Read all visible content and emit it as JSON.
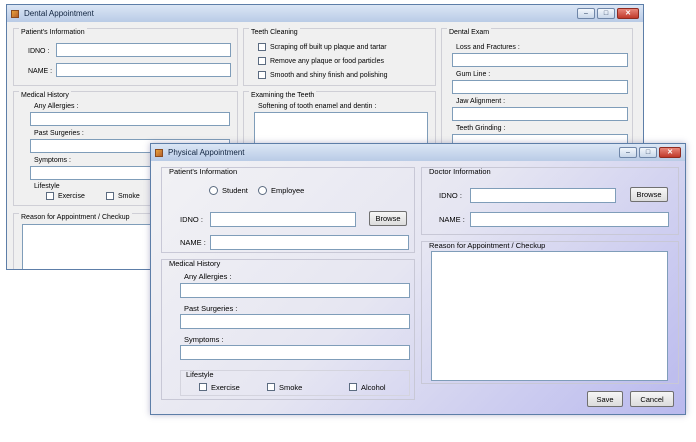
{
  "dental": {
    "title": "Dental Appointment",
    "patients_info": {
      "legend": "Patient's Information",
      "idno_label": "IDNO :",
      "name_label": "NAME :"
    },
    "medical_history": {
      "legend": "Medical History",
      "allergies_label": "Any Allergies :",
      "surgeries_label": "Past Surgeries :",
      "symptoms_label": "Symptoms :",
      "lifestyle_label": "Lifestyle",
      "exercise_label": "Exercise",
      "smoke_label": "Smoke"
    },
    "reason": {
      "legend": "Reason for Appointment / Checkup"
    },
    "teeth_cleaning": {
      "legend": "Teeth Cleaning",
      "opt1": "Scraping off built up plaque and tartar",
      "opt2": "Remove any plaque or food particles",
      "opt3": "Smooth and shiny finish and polishing"
    },
    "examining": {
      "legend": "Examining the Teeth",
      "softening_label": "Softening of tooth enamel and dentin :"
    },
    "dental_exam": {
      "legend": "Dental Exam",
      "loss_label": "Loss and Fractures :",
      "gum_label": "Gum Line :",
      "jaw_label": "Jaw Alignment :",
      "grinding_label": "Teeth Grinding :"
    },
    "caption": {
      "min": "–",
      "max": "□",
      "close": "✕"
    }
  },
  "physical": {
    "title": "Physical Appointment",
    "patients_info": {
      "legend": "Patient's Information",
      "student_label": "Student",
      "employee_label": "Employee",
      "idno_label": "IDNO :",
      "name_label": "NAME :",
      "browse_label": "Browse"
    },
    "doctor_info": {
      "legend": "Doctor Information",
      "idno_label": "IDNO :",
      "name_label": "NAME :",
      "browse_label": "Browse"
    },
    "reason": {
      "legend": "Reason for Appointment / Checkup"
    },
    "medical_history": {
      "legend": "Medical History",
      "allergies_label": "Any Allergies :",
      "surgeries_label": "Past Surgeries :",
      "symptoms_label": "Symptoms :",
      "lifestyle_label": "Lifestyle",
      "exercise_label": "Exercise",
      "smoke_label": "Smoke",
      "alcohol_label": "Alcohol"
    },
    "save_label": "Save",
    "cancel_label": "Cancel",
    "caption": {
      "min": "–",
      "max": "□",
      "close": "✕"
    }
  }
}
